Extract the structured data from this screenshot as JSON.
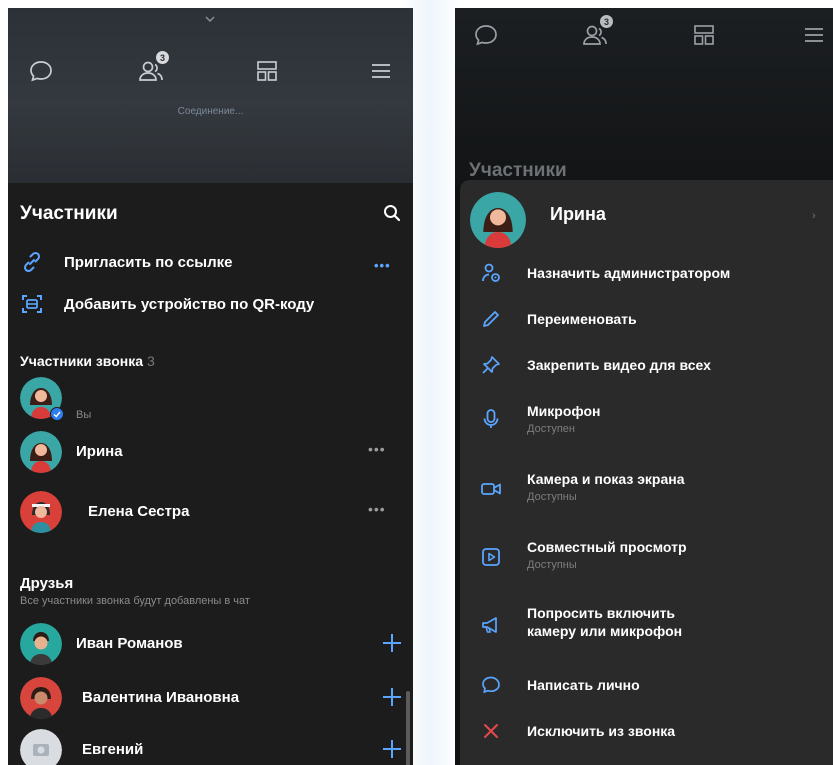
{
  "left": {
    "status": "Соединение...",
    "participants_badge": "3",
    "title": "Участники",
    "actions": [
      {
        "label": "Пригласить по ссылке"
      },
      {
        "label": "Добавить устройство по QR-коду"
      }
    ],
    "invite_more": "•••",
    "call_section": {
      "title": "Участники звонка",
      "count": "3"
    },
    "call_members": [
      {
        "name": "",
        "sublabel": "Вы",
        "avatar_color": "#3aa7a6"
      },
      {
        "name": "Ирина",
        "more": "•••",
        "avatar_color": "#3aa7a6"
      },
      {
        "name": "Елена Сестра",
        "more": "•••",
        "avatar_color": "#d9403a"
      }
    ],
    "friends_section": {
      "title": "Друзья",
      "subtitle": "Все участники звонка будут добавлены в чат"
    },
    "friends": [
      {
        "name": "Иван Романов",
        "avatar_color": "#27a89e"
      },
      {
        "name": "Валентина Ивановна",
        "avatar_color": "#d7453d"
      },
      {
        "name": "Евгений",
        "avatar_color": "#d9dde2"
      }
    ]
  },
  "right": {
    "participants_badge": "3",
    "behind_title": "Участники",
    "menu_header": {
      "name": "Ирина"
    },
    "menu_items": [
      {
        "label": "Назначить администратором",
        "sub": "",
        "icon": "admin-icon"
      },
      {
        "label": "Переименовать",
        "sub": "",
        "icon": "pencil-icon"
      },
      {
        "label": "Закрепить видео для всех",
        "sub": "",
        "icon": "pin-icon"
      },
      {
        "label": "Микрофон",
        "sub": "Доступен",
        "icon": "microphone-icon"
      },
      {
        "label": "Камера и показ экрана",
        "sub": "Доступны",
        "icon": "camera-icon"
      },
      {
        "label": "Совместный просмотр",
        "sub": "Доступны",
        "icon": "watch-together-icon"
      },
      {
        "label": "Попросить включить",
        "label2": "камеру или микрофон",
        "sub": "",
        "icon": "megaphone-icon"
      },
      {
        "label": "Написать лично",
        "sub": "",
        "icon": "message-icon"
      },
      {
        "label": "Исключить из звонка",
        "sub": "",
        "icon": "remove-icon"
      }
    ]
  },
  "colors": {
    "accent_blue": "#5aa5ff",
    "remove_red": "#e5484d",
    "sheet_bg": "#1c1c1c",
    "menu_bg": "#2a2a2a"
  }
}
